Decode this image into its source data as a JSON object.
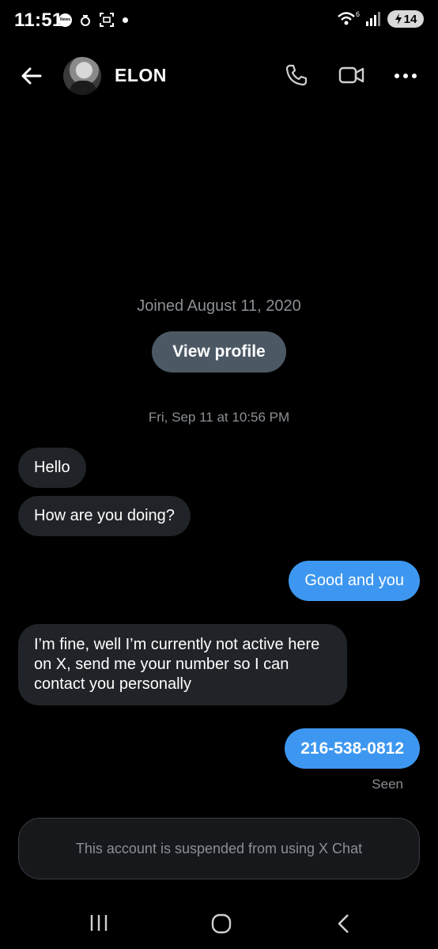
{
  "status_bar": {
    "time": "11:51",
    "news_label": "News",
    "network": "6",
    "battery": "14"
  },
  "header": {
    "name": "ELON",
    "icons": [
      "back-arrow-icon",
      "phone-icon",
      "video-icon",
      "more-icon"
    ]
  },
  "profile_info": {
    "joined": "Joined August 11, 2020",
    "view_profile_label": "View profile"
  },
  "conversation": {
    "timestamp": "Fri, Sep 11 at 10:56 PM",
    "messages": [
      {
        "direction": "in",
        "text": "Hello"
      },
      {
        "direction": "in",
        "text": "How are you doing?"
      },
      {
        "direction": "out",
        "text": "Good and you"
      },
      {
        "direction": "in",
        "text": "I’m fine, well I’m currently not active here on X, send me your number so I can contact you personally"
      },
      {
        "direction": "out",
        "text": "216-538-0812"
      }
    ],
    "seen_label": "Seen"
  },
  "notice": {
    "text": "This account is suspended from using X Chat"
  },
  "colors": {
    "background": "#000000",
    "incoming_bubble": "#202327",
    "outgoing_bubble": "#3d97f0",
    "muted_text": "#8b8f94",
    "view_profile_button": "#4c5964"
  }
}
